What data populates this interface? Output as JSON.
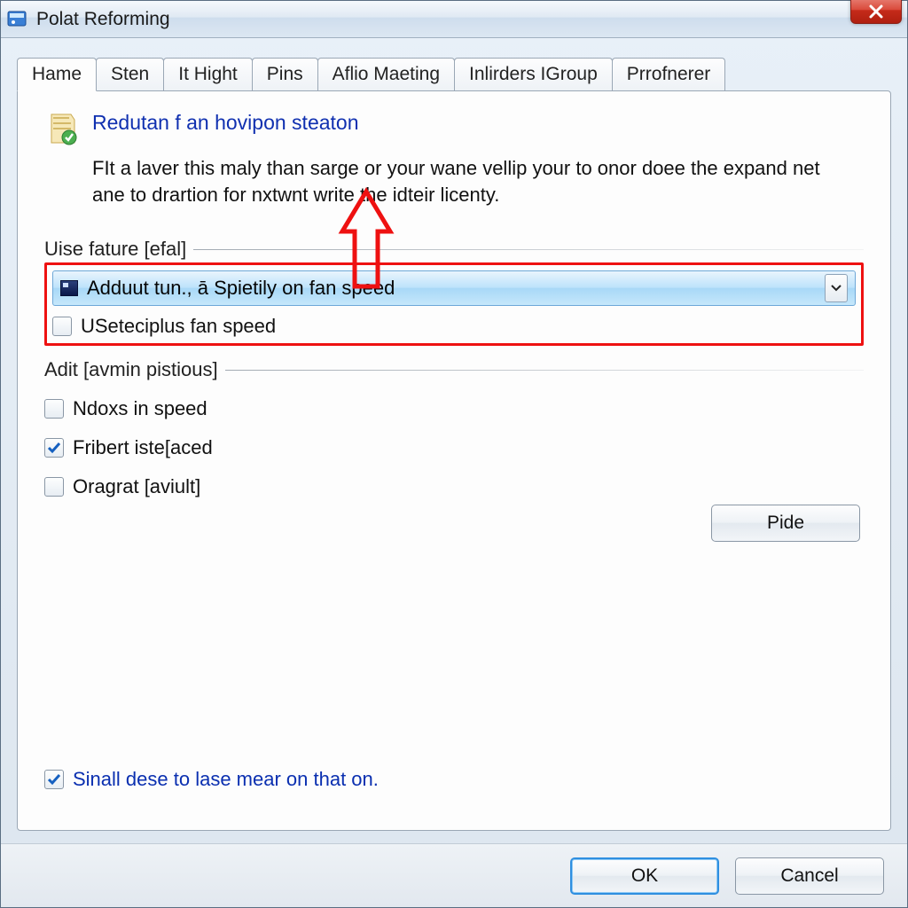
{
  "window": {
    "title": "Polat Reforming"
  },
  "tabs": [
    "Hame",
    "Sten",
    "It Hight",
    "Pins",
    "Aflio Maeting",
    "Inlirders IGroup",
    "Prrofnerer"
  ],
  "active_tab_index": 0,
  "panel": {
    "heading": "Redutan f an hovipon steaton",
    "description": "FIt a laver this maly than sarge or your wane vellip your to onor doee the expand net ane to drartion for nxtwnt write the idteir licenty.",
    "group1_label": "Uise fature [efal]",
    "combo_value": "Adduut tun., ā Spietily on fan speed",
    "group1_check1": "USeteciplus fan speed",
    "group2_label": "Adit [avmin pistious]",
    "options": [
      {
        "label": "Ndoxs in speed",
        "checked": false
      },
      {
        "label": "Fribert iste[aced",
        "checked": true
      },
      {
        "label": "Oragrat [aviult]",
        "checked": false
      }
    ],
    "pide_label": "Pide",
    "bottom_check": {
      "label": "Sinall dese to lase mear on that on.",
      "checked": true
    }
  },
  "buttons": {
    "ok": "OK",
    "cancel": "Cancel"
  }
}
